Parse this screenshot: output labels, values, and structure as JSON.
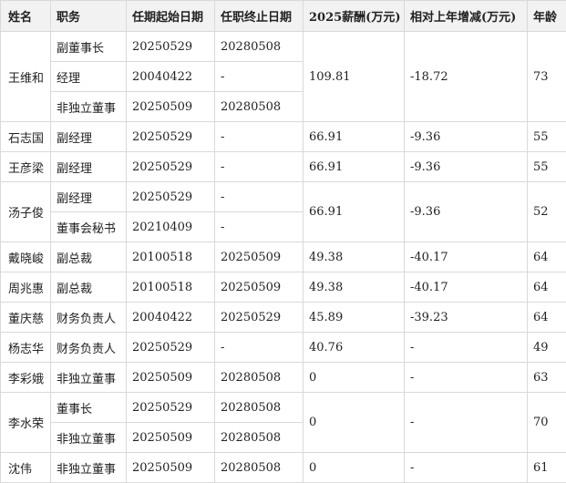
{
  "table": {
    "headers": [
      "姓名",
      "职务",
      "任期起始日期",
      "任职终止日期",
      "2025薪酬(万元)",
      "相对上年增减(万元)",
      "年龄"
    ],
    "rows": [
      {
        "name": "王维和",
        "salary": "109.81",
        "change": "-18.72",
        "age": "73",
        "roles": [
          {
            "title": "副董事长",
            "start": "20250529",
            "end": "20280508"
          },
          {
            "title": "经理",
            "start": "20040422",
            "end": "-"
          },
          {
            "title": "非独立董事",
            "start": "20250509",
            "end": "20280508"
          }
        ]
      },
      {
        "name": "石志国",
        "salary": "66.91",
        "change": "-9.36",
        "age": "55",
        "roles": [
          {
            "title": "副经理",
            "start": "20250529",
            "end": "-"
          }
        ]
      },
      {
        "name": "王彦梁",
        "salary": "66.91",
        "change": "-9.36",
        "age": "55",
        "roles": [
          {
            "title": "副经理",
            "start": "20250529",
            "end": "-"
          }
        ]
      },
      {
        "name": "汤子俊",
        "salary": "66.91",
        "change": "-9.36",
        "age": "52",
        "roles": [
          {
            "title": "副经理",
            "start": "20250529",
            "end": "-"
          },
          {
            "title": "董事会秘书",
            "start": "20210409",
            "end": "-"
          }
        ]
      },
      {
        "name": "戴晓峻",
        "salary": "49.38",
        "change": "-40.17",
        "age": "64",
        "roles": [
          {
            "title": "副总裁",
            "start": "20100518",
            "end": "20250509"
          }
        ]
      },
      {
        "name": "周兆惠",
        "salary": "49.38",
        "change": "-40.17",
        "age": "64",
        "roles": [
          {
            "title": "副总裁",
            "start": "20100518",
            "end": "20250509"
          }
        ]
      },
      {
        "name": "董庆慈",
        "salary": "45.89",
        "change": "-39.23",
        "age": "64",
        "roles": [
          {
            "title": "财务负责人",
            "start": "20040422",
            "end": "20250529"
          }
        ]
      },
      {
        "name": "杨志华",
        "salary": "40.76",
        "change": "-",
        "age": "49",
        "roles": [
          {
            "title": "财务负责人",
            "start": "20250529",
            "end": "-"
          }
        ]
      },
      {
        "name": "李彩娥",
        "salary": "0",
        "change": "-",
        "age": "63",
        "roles": [
          {
            "title": "非独立董事",
            "start": "20250509",
            "end": "20280508"
          }
        ]
      },
      {
        "name": "李水荣",
        "salary": "0",
        "change": "-",
        "age": "70",
        "roles": [
          {
            "title": "董事长",
            "start": "20250529",
            "end": "20280508"
          },
          {
            "title": "非独立董事",
            "start": "20250509",
            "end": "20280508"
          }
        ]
      },
      {
        "name": "沈伟",
        "salary": "0",
        "change": "-",
        "age": "61",
        "roles": [
          {
            "title": "非独立董事",
            "start": "20250509",
            "end": "20280508"
          }
        ]
      }
    ]
  }
}
